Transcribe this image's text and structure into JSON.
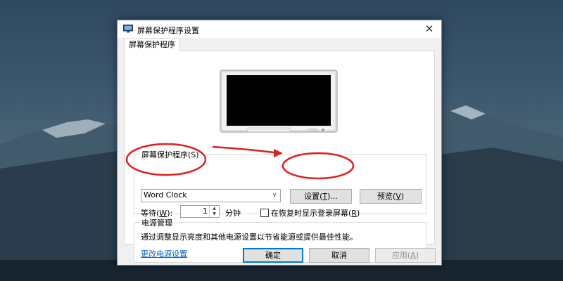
{
  "window": {
    "title": "屏幕保护程序设置",
    "close_symbol": "✕",
    "tab_label": "屏幕保护程序"
  },
  "screensaver": {
    "group_label": "屏幕保护程序(S)",
    "selected": "Word Clock",
    "settings_label_pre": "设置(",
    "settings_key": "T",
    "settings_label_post": ")...",
    "preview_label_pre": "预览(",
    "preview_key": "V",
    "preview_label_post": ")",
    "wait_label_pre": "等待(",
    "wait_key": "W",
    "wait_label_post": "):",
    "wait_value": "1",
    "wait_unit": "分钟",
    "resume_checkbox_label_pre": "在恢复时显示登录屏幕(",
    "resume_checkbox_key": "R",
    "resume_checkbox_label_post": ")",
    "resume_checked": false
  },
  "power": {
    "group_label": "电源管理",
    "description": "通过调整显示亮度和其他电源设置以节省能源或提供最佳性能。",
    "link": "更改电源设置"
  },
  "footer": {
    "ok_label": "确定",
    "cancel_label": "取消",
    "apply_label_pre": "应用(",
    "apply_key": "A",
    "apply_label_post": ")"
  },
  "icons": {
    "title": "monitor-icon",
    "close": "close-icon",
    "dropdown": "chevron-down-icon",
    "spin_up": "arrow-up-icon",
    "spin_down": "arrow-down-icon"
  },
  "colors": {
    "link": "#0066cc",
    "annotation": "#e0201c",
    "accent": "#0078d7"
  }
}
